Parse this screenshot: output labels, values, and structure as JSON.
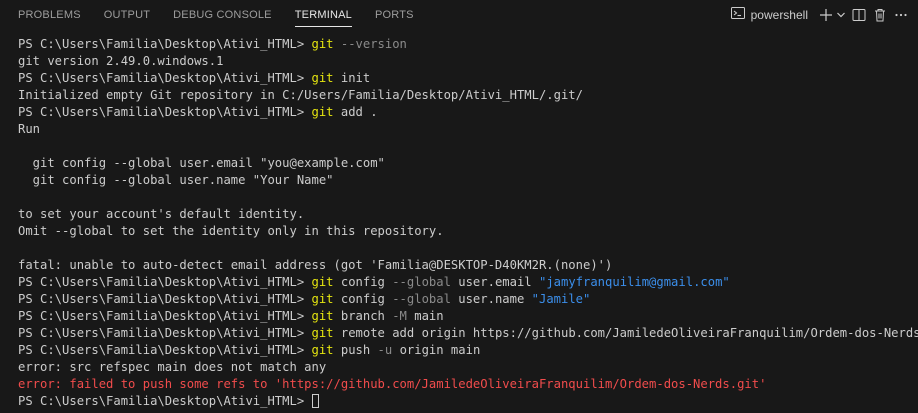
{
  "tabs": [
    {
      "label": "PROBLEMS",
      "active": false
    },
    {
      "label": "OUTPUT",
      "active": false
    },
    {
      "label": "DEBUG CONSOLE",
      "active": false
    },
    {
      "label": "TERMINAL",
      "active": true
    },
    {
      "label": "PORTS",
      "active": false
    }
  ],
  "toolbar": {
    "shell_label": "powershell",
    "icons": [
      "terminal-icon",
      "plus-icon",
      "chevron-down-icon",
      "split-icon",
      "trash-icon",
      "ellipsis-icon"
    ]
  },
  "colors": {
    "background": "#181818",
    "command": "#e5e510",
    "parameter": "#8a8a8a",
    "string": "#3b8eea",
    "error": "#f14c4c",
    "text": "#cccccc"
  },
  "terminal": {
    "prompt": "PS C:\\Users\\Familia\\Desktop\\Ativi_HTML> ",
    "lines": [
      {
        "segments": [
          {
            "t": "PS C:\\Users\\Familia\\Desktop\\Ativi_HTML> ",
            "c": "plain"
          },
          {
            "t": "git",
            "c": "cmd"
          },
          {
            "t": " --version",
            "c": "param"
          }
        ]
      },
      {
        "segments": [
          {
            "t": "git version 2.49.0.windows.1",
            "c": "plain"
          }
        ]
      },
      {
        "segments": [
          {
            "t": "PS C:\\Users\\Familia\\Desktop\\Ativi_HTML> ",
            "c": "plain"
          },
          {
            "t": "git",
            "c": "cmd"
          },
          {
            "t": " init",
            "c": "plain"
          }
        ]
      },
      {
        "segments": [
          {
            "t": "Initialized empty Git repository in C:/Users/Familia/Desktop/Ativi_HTML/.git/",
            "c": "plain"
          }
        ]
      },
      {
        "segments": [
          {
            "t": "PS C:\\Users\\Familia\\Desktop\\Ativi_HTML> ",
            "c": "plain"
          },
          {
            "t": "git",
            "c": "cmd"
          },
          {
            "t": " add .",
            "c": "plain"
          }
        ]
      },
      {
        "segments": [
          {
            "t": "Run",
            "c": "plain"
          }
        ]
      },
      {
        "segments": [
          {
            "t": "",
            "c": "plain"
          }
        ]
      },
      {
        "segments": [
          {
            "t": "  git config --global user.email \"you@example.com\"",
            "c": "plain"
          }
        ]
      },
      {
        "segments": [
          {
            "t": "  git config --global user.name \"Your Name\"",
            "c": "plain"
          }
        ]
      },
      {
        "segments": [
          {
            "t": "",
            "c": "plain"
          }
        ]
      },
      {
        "segments": [
          {
            "t": "to set your account's default identity.",
            "c": "plain"
          }
        ]
      },
      {
        "segments": [
          {
            "t": "Omit --global to set the identity only in this repository.",
            "c": "plain"
          }
        ]
      },
      {
        "segments": [
          {
            "t": "",
            "c": "plain"
          }
        ]
      },
      {
        "segments": [
          {
            "t": "fatal: unable to auto-detect email address (got 'Familia@DESKTOP-D40KM2R.(none)')",
            "c": "plain"
          }
        ]
      },
      {
        "segments": [
          {
            "t": "PS C:\\Users\\Familia\\Desktop\\Ativi_HTML> ",
            "c": "plain"
          },
          {
            "t": "git",
            "c": "cmd"
          },
          {
            "t": " config ",
            "c": "plain"
          },
          {
            "t": "--global",
            "c": "param"
          },
          {
            "t": " user.email ",
            "c": "plain"
          },
          {
            "t": "\"jamyfranquilim@gmail.com\"",
            "c": "str"
          }
        ]
      },
      {
        "segments": [
          {
            "t": "PS C:\\Users\\Familia\\Desktop\\Ativi_HTML> ",
            "c": "plain"
          },
          {
            "t": "git",
            "c": "cmd"
          },
          {
            "t": " config ",
            "c": "plain"
          },
          {
            "t": "--global",
            "c": "param"
          },
          {
            "t": " user.name ",
            "c": "plain"
          },
          {
            "t": "\"Jamile\"",
            "c": "str"
          }
        ]
      },
      {
        "segments": [
          {
            "t": "PS C:\\Users\\Familia\\Desktop\\Ativi_HTML> ",
            "c": "plain"
          },
          {
            "t": "git",
            "c": "cmd"
          },
          {
            "t": " branch ",
            "c": "plain"
          },
          {
            "t": "-M",
            "c": "param"
          },
          {
            "t": " main",
            "c": "plain"
          }
        ]
      },
      {
        "segments": [
          {
            "t": "PS C:\\Users\\Familia\\Desktop\\Ativi_HTML> ",
            "c": "plain"
          },
          {
            "t": "git",
            "c": "cmd"
          },
          {
            "t": " remote add origin https://github.com/JamiledeOliveiraFranquilim/Ordem-dos-Nerds.git",
            "c": "plain"
          }
        ]
      },
      {
        "segments": [
          {
            "t": "PS C:\\Users\\Familia\\Desktop\\Ativi_HTML> ",
            "c": "plain"
          },
          {
            "t": "git",
            "c": "cmd"
          },
          {
            "t": " push ",
            "c": "plain"
          },
          {
            "t": "-u",
            "c": "param"
          },
          {
            "t": " origin main",
            "c": "plain"
          }
        ]
      },
      {
        "segments": [
          {
            "t": "error: src refspec main does not match any",
            "c": "plain"
          }
        ]
      },
      {
        "segments": [
          {
            "t": "error: failed to push some refs to 'https://github.com/JamiledeOliveiraFranquilim/Ordem-dos-Nerds.git'",
            "c": "err"
          }
        ]
      },
      {
        "segments": [
          {
            "t": "PS C:\\Users\\Familia\\Desktop\\Ativi_HTML> ",
            "c": "plain"
          }
        ],
        "cursor": true
      }
    ]
  }
}
